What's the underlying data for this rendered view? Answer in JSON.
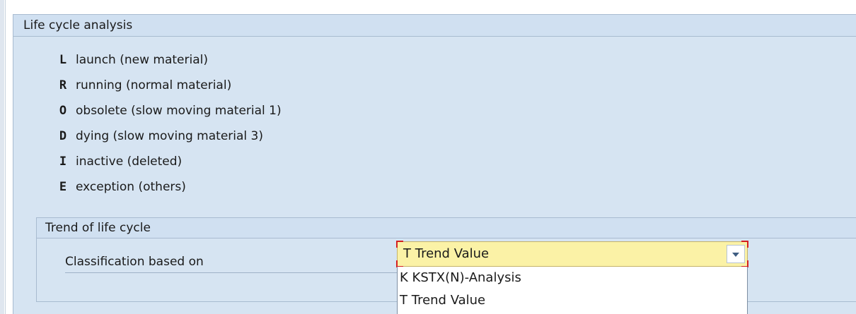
{
  "lifecycle": {
    "title": "Life cycle analysis",
    "statuses": [
      {
        "code": "L",
        "description": "launch (new material)"
      },
      {
        "code": "R",
        "description": "running (normal material)"
      },
      {
        "code": "O",
        "description": "obsolete (slow moving material 1)"
      },
      {
        "code": "D",
        "description": "dying (slow moving material 3)"
      },
      {
        "code": "I",
        "description": "inactive (deleted)"
      },
      {
        "code": "E",
        "description": "exception (others)"
      }
    ]
  },
  "trend": {
    "title": "Trend of life cycle",
    "classification_label": "Classification based on",
    "selected_value": "T Trend Value",
    "options": [
      "K KSTX(N)-Analysis",
      "T Trend Value"
    ]
  },
  "colors": {
    "panel_bg": "#d6e4f2",
    "field_bg": "#fbf2a6",
    "focus_marker": "#d42020"
  },
  "icons": {
    "dropdown_button": "chevron-down-icon"
  }
}
